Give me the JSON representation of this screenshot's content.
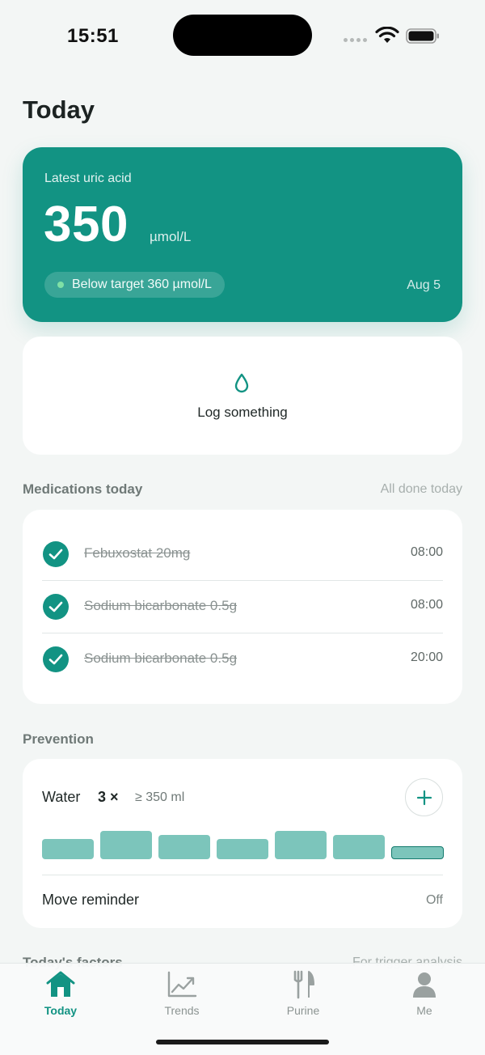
{
  "status_bar": {
    "time": "15:51"
  },
  "page": {
    "title": "Today"
  },
  "uric_acid": {
    "label": "Latest uric acid",
    "value": "350",
    "unit": "µmol/L",
    "status": "Below target 360 µmol/L",
    "date": "Aug 5"
  },
  "log": {
    "label": "Log something",
    "icon": "water-drop-icon"
  },
  "medications": {
    "title": "Medications today",
    "status": "All done today",
    "items": [
      {
        "name": "Febuxostat 20mg",
        "time": "08:00",
        "taken": true
      },
      {
        "name": "Sodium bicarbonate 0.5g",
        "time": "08:00",
        "taken": true
      },
      {
        "name": "Sodium bicarbonate 0.5g",
        "time": "20:00",
        "taken": true
      }
    ]
  },
  "prevention": {
    "title": "Prevention",
    "water": {
      "label": "Water",
      "count": "3 ×",
      "minimum": "≥ 350 ml",
      "cups_total": 7
    },
    "reminder": {
      "label": "Move reminder",
      "value": "Off"
    }
  },
  "factors": {
    "title": "Today's factors",
    "aside": "For trigger analysis"
  },
  "tabbar": {
    "tabs": [
      {
        "label": "Today",
        "icon": "home-icon",
        "active": true
      },
      {
        "label": "Trends",
        "icon": "trend-chart-icon",
        "active": false
      },
      {
        "label": "Purine",
        "icon": "fork-knife-icon",
        "active": false
      },
      {
        "label": "Me",
        "icon": "person-icon",
        "active": false
      }
    ]
  },
  "colors": {
    "accent": "#129383",
    "water_cup": "#7cc5bb",
    "background": "#f3f6f5"
  }
}
